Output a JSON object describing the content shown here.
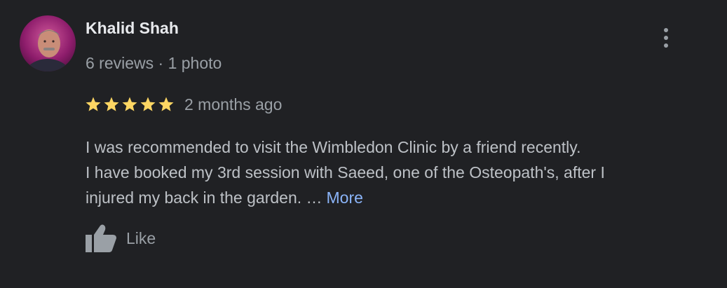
{
  "review": {
    "author": "Khalid Shah",
    "meta": "6 reviews · 1 photo",
    "rating": 5,
    "rating_max": 5,
    "date": "2 months ago",
    "text_lines": [
      "I was recommended to visit the Wimbledon Clinic by a friend recently.",
      "I have booked my 3rd session with Saeed, one of the Osteopath's, after I",
      "injured my back in the garden. …"
    ],
    "more_label": "More",
    "like_label": "Like"
  },
  "colors": {
    "background": "#202124",
    "star": "#fdd663",
    "link": "#8ab4f8",
    "muted": "#9aa0a6",
    "author": "#e8eaed"
  },
  "icons": {
    "menu": "more-vert-icon",
    "like": "thumb-up-icon",
    "star": "star-icon"
  }
}
